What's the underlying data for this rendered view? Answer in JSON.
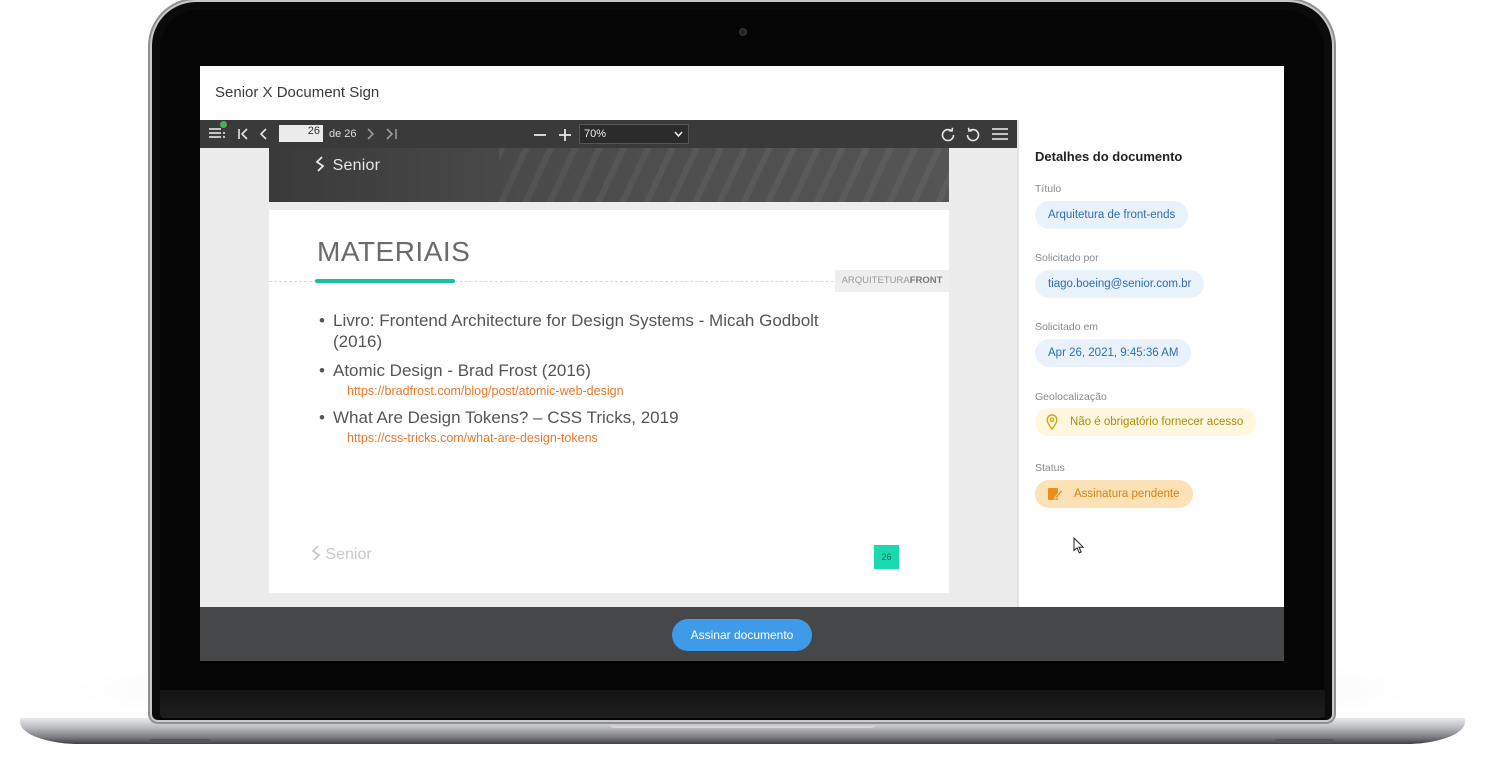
{
  "app": {
    "title": "Senior X Document Sign"
  },
  "toolbar": {
    "current_page": "26",
    "page_of": "de 26",
    "zoom": "70%"
  },
  "slide_header": {
    "brand": "Senior"
  },
  "slide": {
    "title": "MATERIAIS",
    "tag_light": "ARQUITETURA",
    "tag_bold": "FRONT",
    "bullets": [
      {
        "line1": "Livro: Frontend  Architecture for Design Systems - Micah Godbolt",
        "line2": "(2016)"
      },
      {
        "line1": "Atomic Design - Brad Frost (2016)",
        "link": "https://bradfrost.com/blog/post/atomic-web-design"
      },
      {
        "line1": "What Are Design Tokens? – CSS Tricks, 2019",
        "link": "https://css-tricks.com/what-are-design-tokens"
      }
    ],
    "bullet_char": "•",
    "footer_brand": "Senior",
    "page_number": "26"
  },
  "sidebar": {
    "heading": "Detalhes do documento",
    "fields": [
      {
        "label": "Título",
        "value": "Arquitetura de front-ends"
      },
      {
        "label": "Solicitado por",
        "value": "tiago.boeing@senior.com.br"
      },
      {
        "label": "Solicitado em",
        "value": "Apr 26, 2021, 9:45:36 AM"
      },
      {
        "label": "Geolocalização",
        "value": "Não é obrigatório fornecer acesso",
        "icon": "location-pin-icon"
      },
      {
        "label": "Status",
        "value": "Assinatura pendente",
        "icon": "edit-document-icon"
      }
    ]
  },
  "footer": {
    "sign_label": "Assinar documento"
  },
  "colors": {
    "accent": "#3d9be9",
    "slide_accent": "#16c2a3",
    "link": "#e8792b",
    "status_pending_bg": "#fde2b8",
    "status_pending_text": "#d9820f"
  }
}
